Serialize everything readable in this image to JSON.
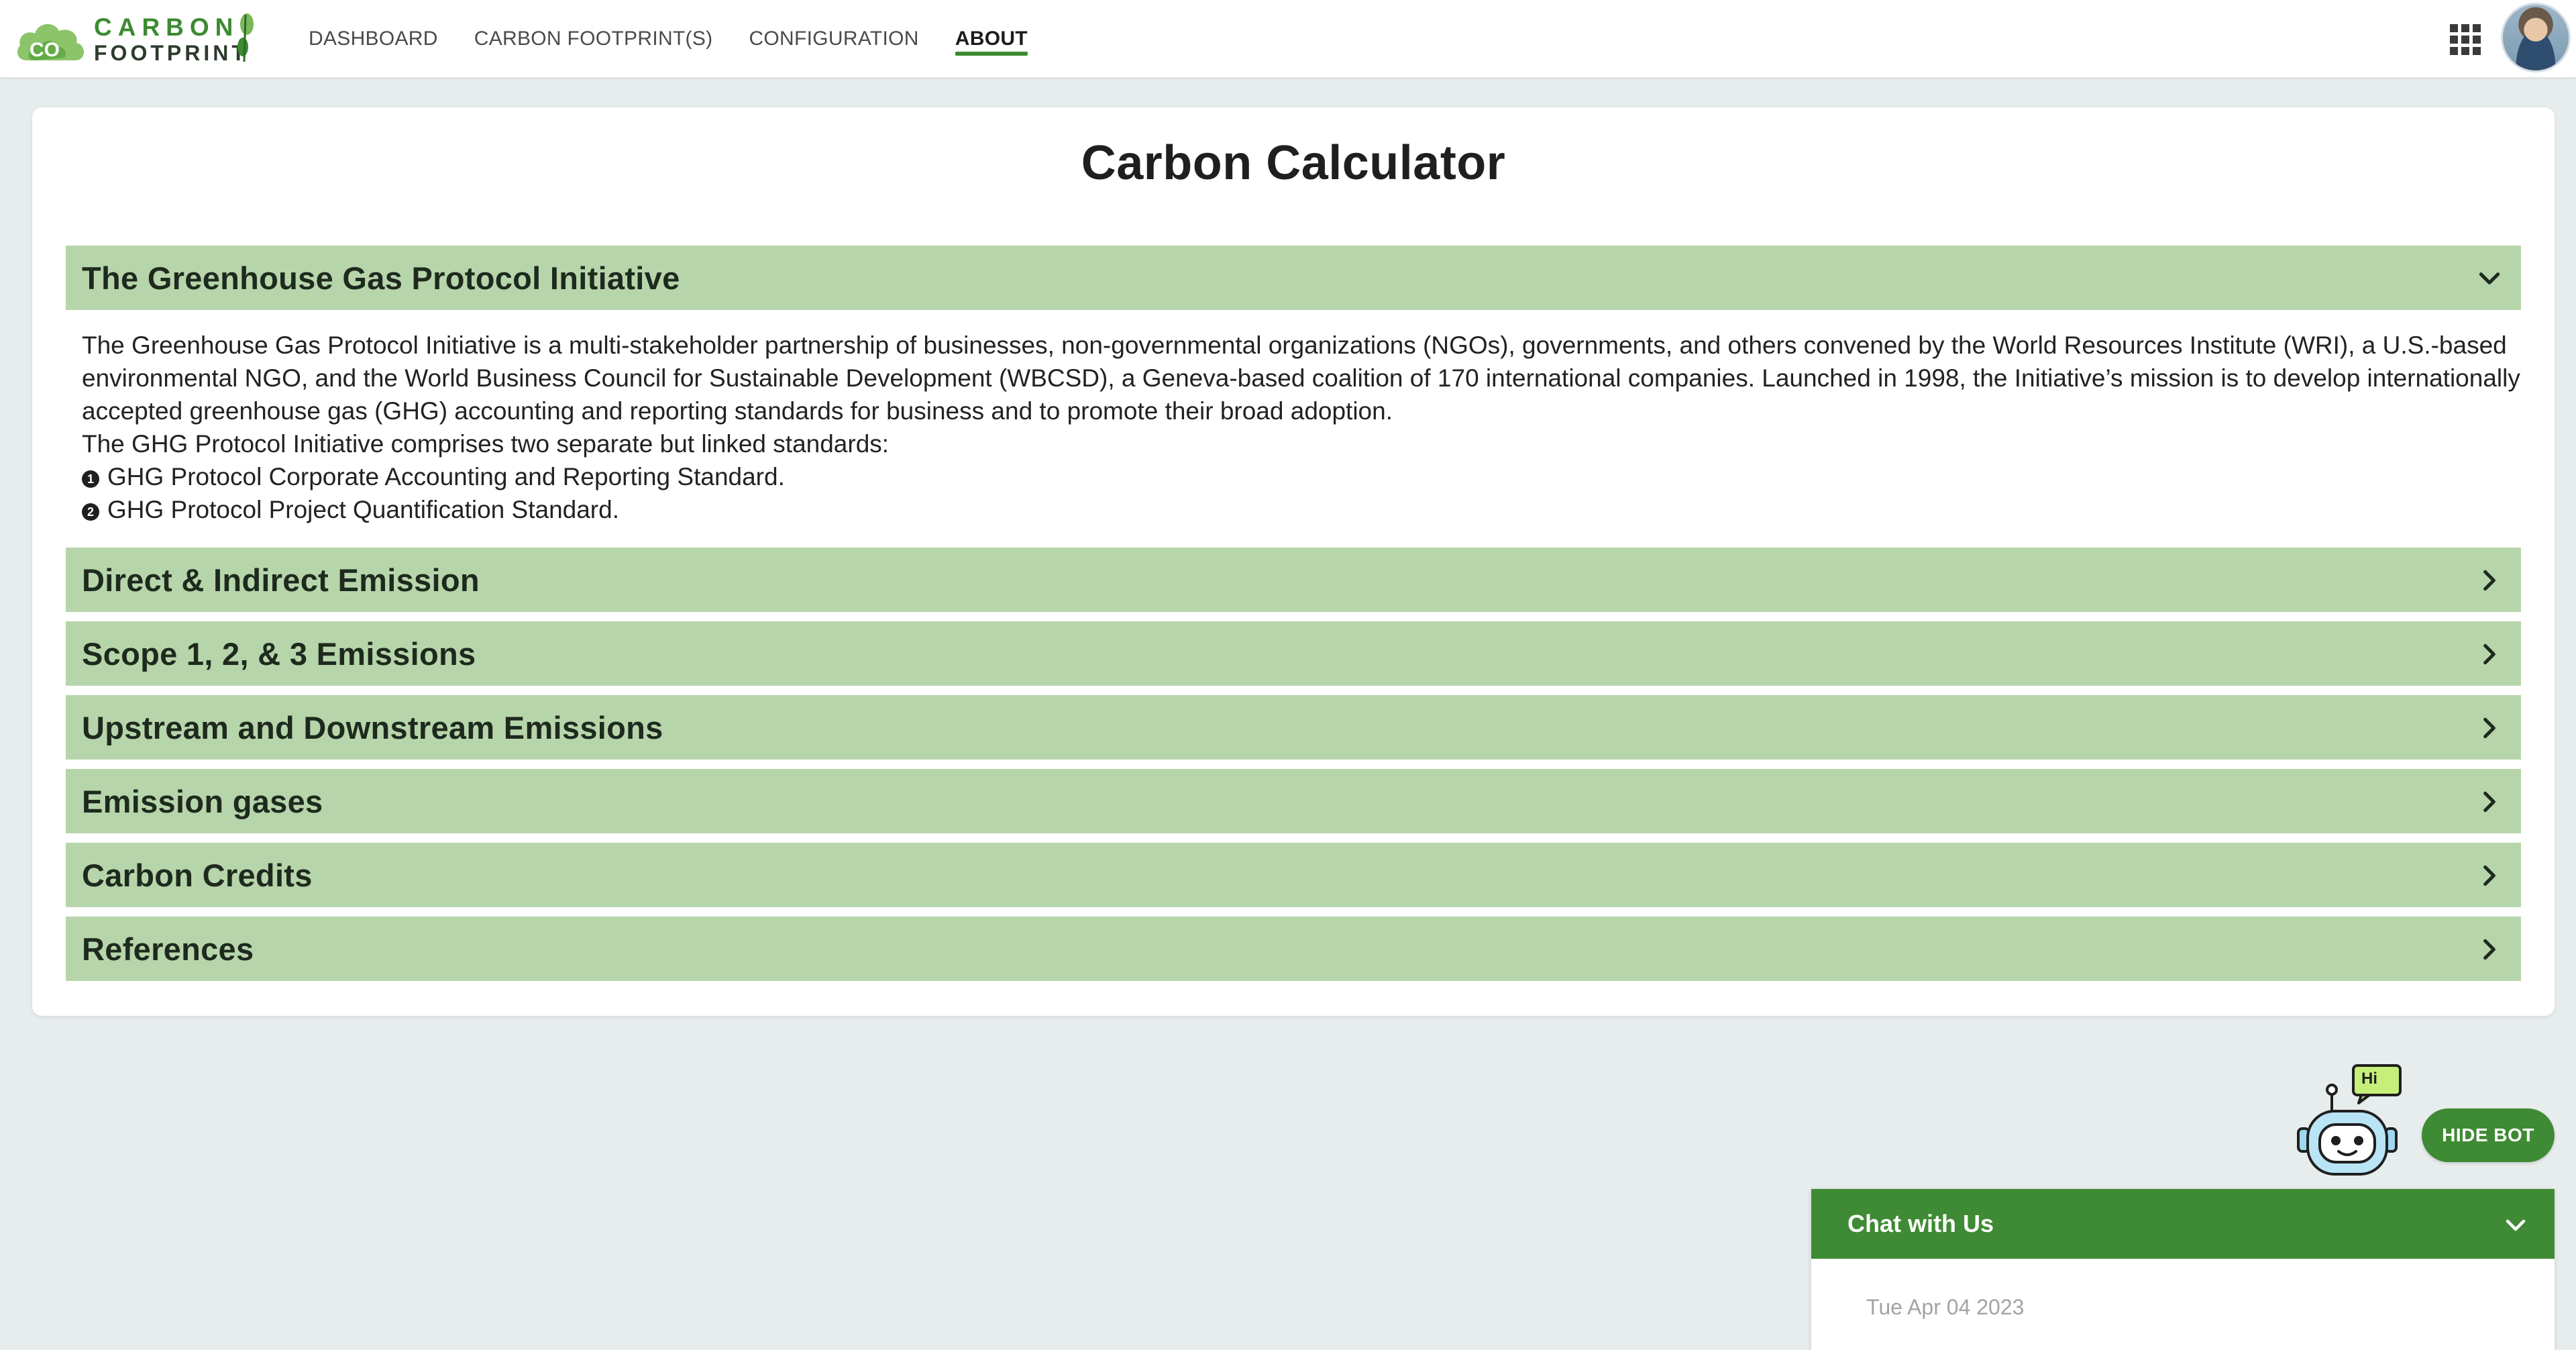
{
  "brand": {
    "logo_line1": "CARBON",
    "logo_line2": "FOOTPRINT",
    "logo_badge": "CO",
    "accent_color": "#3c8a32",
    "header_color": "#b7d5aa"
  },
  "nav": {
    "items": [
      {
        "label": "DASHBOARD",
        "active": false
      },
      {
        "label": "CARBON FOOTPRINT(S)",
        "active": false
      },
      {
        "label": "CONFIGURATION",
        "active": false
      },
      {
        "label": "ABOUT",
        "active": true
      }
    ],
    "apps_icon": "grid-apps-icon",
    "avatar_icon": "user-avatar"
  },
  "page": {
    "title": "Carbon Calculator",
    "sections": [
      {
        "title": "The Greenhouse Gas Protocol Initiative",
        "expanded": true,
        "icon": "chevron-down-icon"
      },
      {
        "title": "Direct & Indirect Emission",
        "expanded": false,
        "icon": "chevron-right-icon"
      },
      {
        "title": "Scope 1, 2, & 3 Emissions",
        "expanded": false,
        "icon": "chevron-right-icon"
      },
      {
        "title": "Upstream and Downstream Emissions",
        "expanded": false,
        "icon": "chevron-right-icon"
      },
      {
        "title": "Emission gases",
        "expanded": false,
        "icon": "chevron-right-icon"
      },
      {
        "title": "Carbon Credits",
        "expanded": false,
        "icon": "chevron-right-icon"
      },
      {
        "title": "References",
        "expanded": false,
        "icon": "chevron-right-icon"
      }
    ],
    "ghg_body": {
      "paragraph": "The Greenhouse Gas Protocol Initiative is a multi-stakeholder partnership of businesses, non-governmental organizations (NGOs), governments, and others convened by the World Resources Institute (WRI), a U.S.-based environmental NGO, and the World Business Council for Sustainable Development (WBCSD), a Geneva-based coalition of 170 international companies. Launched in 1998, the Initiative’s mission is to develop internationally accepted greenhouse gas (GHG) accounting and reporting standards for business and to promote their broad adoption.",
      "intro": "The GHG Protocol Initiative comprises two separate but linked standards:",
      "standards": [
        {
          "bullet": "1",
          "text": "GHG Protocol Corporate Accounting and Reporting Standard."
        },
        {
          "bullet": "2",
          "text": "GHG Protocol Project Quantification Standard."
        }
      ]
    }
  },
  "bot": {
    "speech": "Hi",
    "hide_label": "HIDE BOT",
    "chat_title": "Chat with Us",
    "chat_date": "Tue Apr 04 2023"
  }
}
